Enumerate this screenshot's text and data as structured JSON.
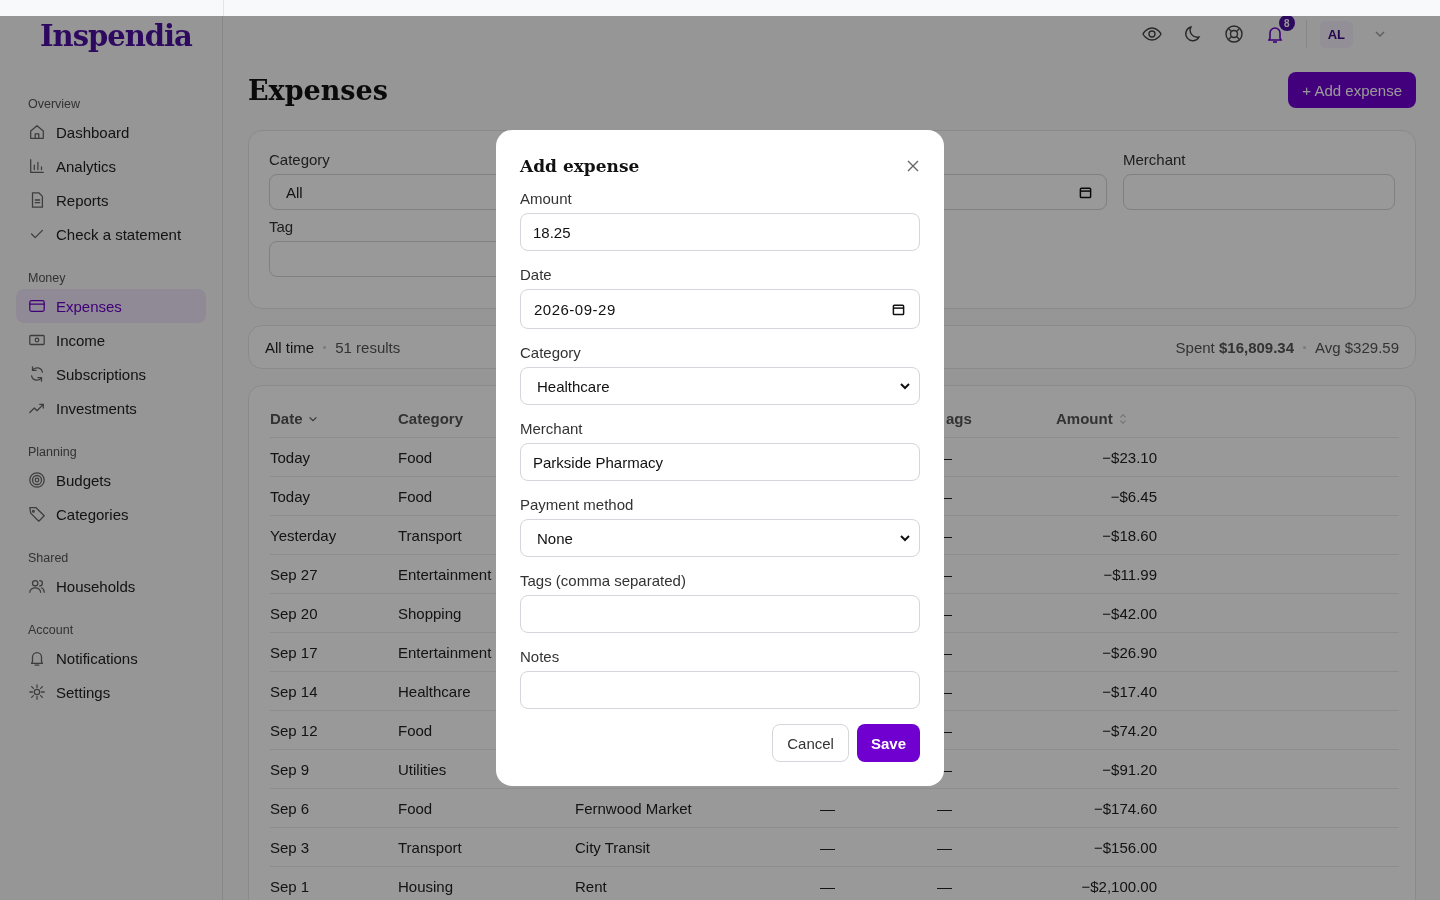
{
  "brand": "Inspendia",
  "sidebar": {
    "sections": [
      {
        "title": "Overview",
        "items": [
          {
            "label": "Dashboard",
            "selected": false
          },
          {
            "label": "Analytics",
            "selected": false
          },
          {
            "label": "Reports",
            "selected": false
          },
          {
            "label": "Check a statement",
            "selected": false
          }
        ]
      },
      {
        "title": "Money",
        "items": [
          {
            "label": "Expenses",
            "selected": true
          },
          {
            "label": "Income",
            "selected": false
          },
          {
            "label": "Subscriptions",
            "selected": false
          },
          {
            "label": "Investments",
            "selected": false
          }
        ]
      },
      {
        "title": "Planning",
        "items": [
          {
            "label": "Budgets",
            "selected": false
          },
          {
            "label": "Categories",
            "selected": false
          }
        ]
      },
      {
        "title": "Shared",
        "items": [
          {
            "label": "Households",
            "selected": false
          }
        ]
      },
      {
        "title": "Account",
        "items": [
          {
            "label": "Notifications",
            "selected": false
          },
          {
            "label": "Settings",
            "selected": false
          }
        ]
      }
    ]
  },
  "topbar": {
    "notification_count": "8",
    "avatar": "AL"
  },
  "page": {
    "title": "Expenses",
    "add_button": "+ Add expense"
  },
  "filters": {
    "category_label": "Category",
    "category_value": "All",
    "merchant_label": "Merchant",
    "tag_label": "Tag"
  },
  "summary": {
    "period": "All time",
    "results": "51 results",
    "spent": "Spent **$16,809.34**",
    "avg": "Avg $329.59"
  },
  "table": {
    "columns": [
      "Date",
      "Category",
      "ags",
      "Amount"
    ],
    "rows": [
      {
        "date": "Today",
        "category": "Food",
        "tags": "—",
        "amount": "−$23.10"
      },
      {
        "date": "Today",
        "category": "Food",
        "tags": "—",
        "amount": "−$6.45"
      },
      {
        "date": "Yesterday",
        "category": "Transport",
        "tags": "—",
        "amount": "−$18.60"
      },
      {
        "date": "Sep 27",
        "category": "Entertainment",
        "tags": "—",
        "amount": "−$11.99"
      },
      {
        "date": "Sep 20",
        "category": "Shopping",
        "tags": "—",
        "amount": "−$42.00"
      },
      {
        "date": "Sep 17",
        "category": "Entertainment",
        "tags": "—",
        "amount": "−$26.90"
      },
      {
        "date": "Sep 14",
        "category": "Healthcare",
        "tags": "—",
        "amount": "−$17.40"
      },
      {
        "date": "Sep 12",
        "category": "Food",
        "tags": "—",
        "amount": "−$74.20"
      },
      {
        "date": "Sep 9",
        "category": "Utilities",
        "tags": "—",
        "amount": "−$91.20"
      },
      {
        "date": "Sep 6",
        "category": "Food",
        "merchant": "Fernwood Market",
        "column_4": "—",
        "tags": "—",
        "amount": "−$174.60"
      },
      {
        "date": "Sep 3",
        "category": "Transport",
        "merchant": "City Transit",
        "column_4": "—",
        "tags": "—",
        "amount": "−$156.00"
      },
      {
        "date": "Sep 1",
        "category": "Housing",
        "merchant": "Rent",
        "column_4": "—",
        "tags": "—",
        "amount": "−$2,100.00"
      }
    ]
  },
  "dialog": {
    "title": "Add expense",
    "fields": [
      {
        "kind": "text",
        "label": "Amount",
        "value": "18.25"
      },
      {
        "kind": "date",
        "label": "Date",
        "value": "2026-09-29"
      },
      {
        "kind": "select",
        "label": "Category",
        "value": "Healthcare"
      },
      {
        "kind": "text",
        "label": "Merchant",
        "value": "Parkside Pharmacy"
      },
      {
        "kind": "select",
        "label": "Payment method",
        "value": "None"
      },
      {
        "kind": "text",
        "label": "Tags (comma separated)"
      },
      {
        "kind": "text",
        "label": "Notes"
      }
    ],
    "cancel": "Cancel",
    "save": "Save"
  }
}
